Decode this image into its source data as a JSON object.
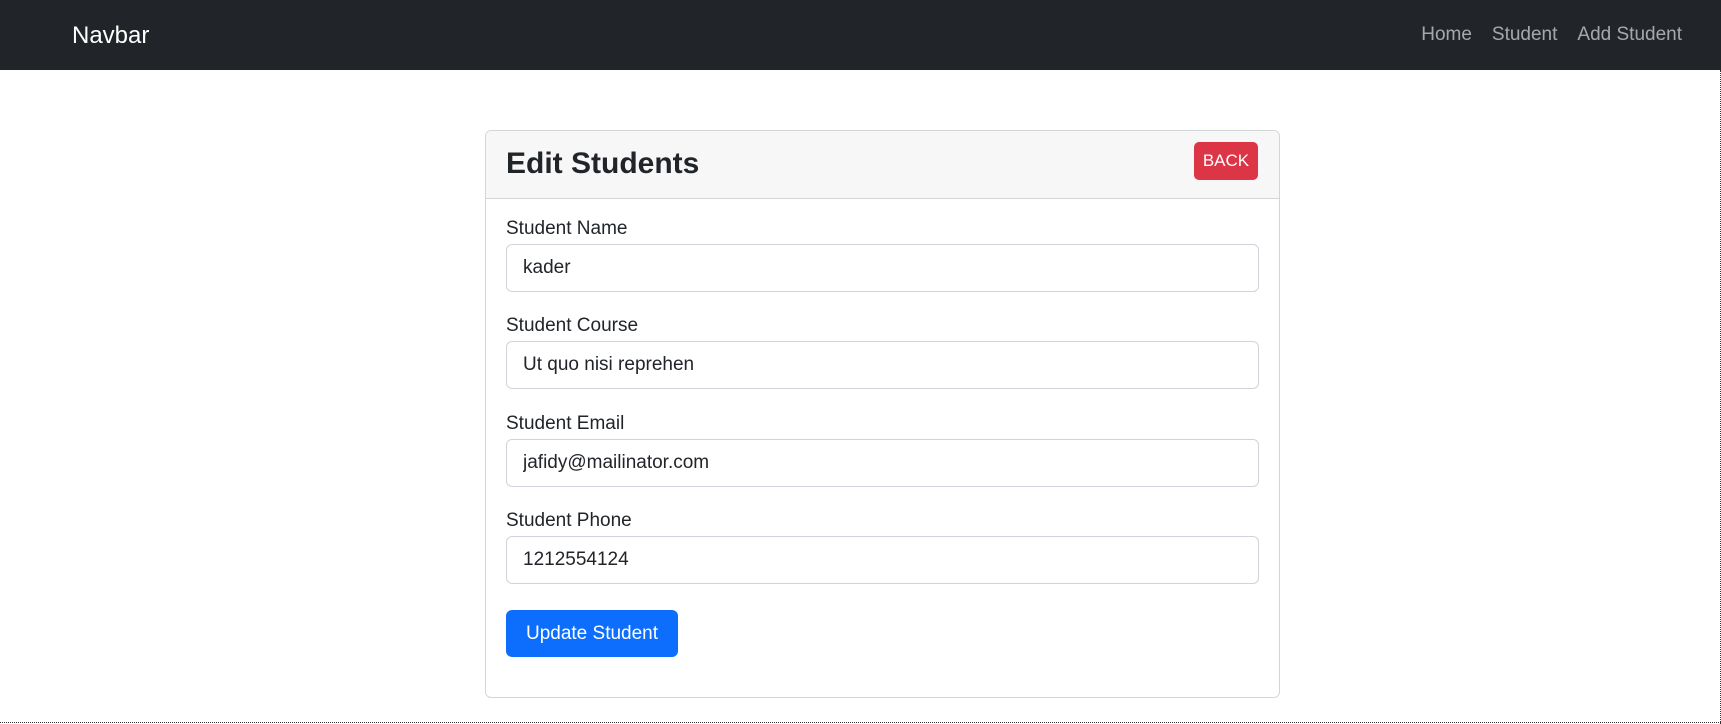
{
  "navbar": {
    "brand": "Navbar",
    "links": [
      {
        "label": "Home"
      },
      {
        "label": "Student"
      },
      {
        "label": "Add Student"
      }
    ]
  },
  "card": {
    "title": "Edit Students",
    "back_label": "BACK"
  },
  "form": {
    "name": {
      "label": "Student Name",
      "value": "kader"
    },
    "course": {
      "label": "Student Course",
      "value": "Ut quo nisi reprehen"
    },
    "email": {
      "label": "Student Email",
      "value": "jafidy@mailinator.com"
    },
    "phone": {
      "label": "Student Phone",
      "value": "1212554124"
    },
    "submit_label": "Update Student"
  },
  "colors": {
    "navbar_bg": "#212529",
    "danger": "#dc3545",
    "primary": "#0d6efd",
    "card_header_bg": "#f7f7f7"
  }
}
